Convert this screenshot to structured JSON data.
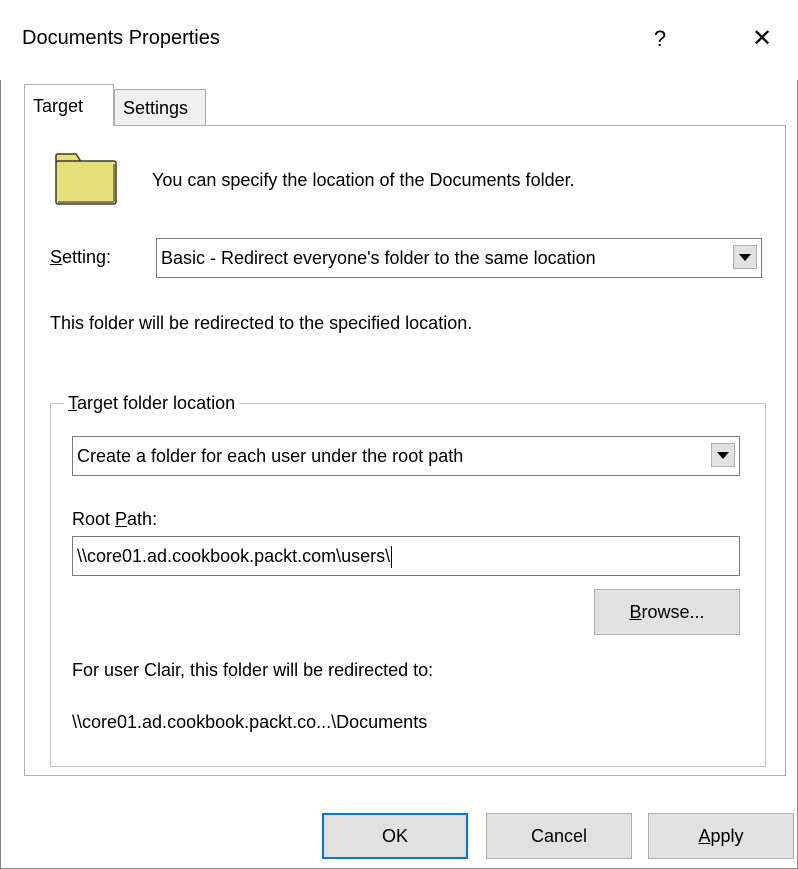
{
  "window": {
    "title": "Documents Properties",
    "help_label": "?",
    "close_label": "✕"
  },
  "tabs": [
    {
      "label": "Target",
      "selected": true
    },
    {
      "label": "Settings",
      "selected": false
    }
  ],
  "intro": {
    "icon": "folder-icon",
    "text": "You can specify the location of the Documents folder."
  },
  "setting": {
    "label_mnemonic": "S",
    "label_rest": "etting:",
    "value": "Basic - Redirect everyone's folder to the same location"
  },
  "redirect_note": "This folder will be redirected to the specified location.",
  "target_group": {
    "legend_mnemonic": "T",
    "legend_rest": "arget folder location",
    "location_value": "Create a folder for each user under the root path",
    "root_label_pre": "Root ",
    "root_label_mnemonic": "P",
    "root_label_post": "ath:",
    "root_path_value": "\\\\core01.ad.cookbook.packt.com\\users\\",
    "browse_mnemonic": "B",
    "browse_rest": "rowse...",
    "user_note": "For user Clair, this folder will be redirected to:",
    "user_path": "\\\\core01.ad.cookbook.packt.co...\\Documents"
  },
  "buttons": {
    "ok": "OK",
    "cancel": "Cancel",
    "apply_mnemonic": "A",
    "apply_rest": "pply"
  },
  "colors": {
    "folder_fill": "#e6e07a",
    "folder_stroke": "#3a3a3a",
    "focus_border": "#0078d7",
    "button_face": "#e1e1e1"
  }
}
